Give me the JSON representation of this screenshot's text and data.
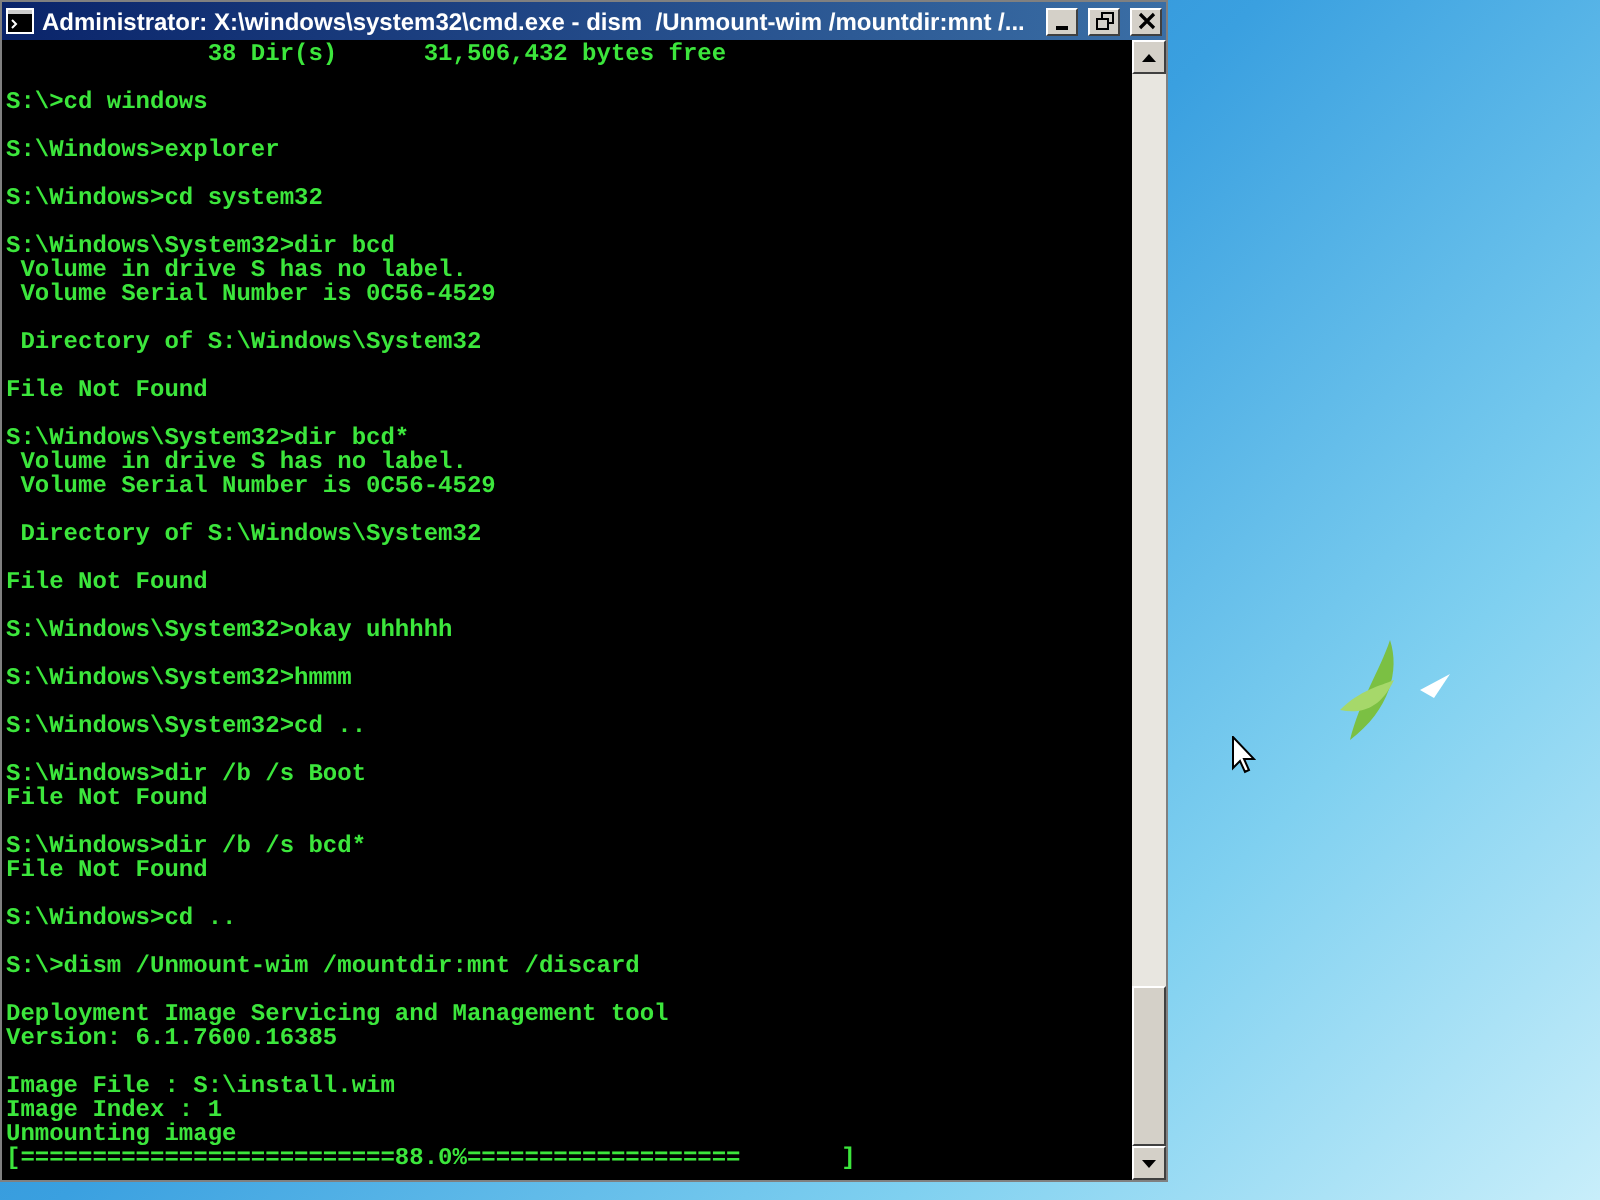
{
  "window": {
    "title": "Administrator: X:\\windows\\system32\\cmd.exe - dism  /Unmount-wim /mountdir:mnt /..."
  },
  "console": {
    "blocks": [
      [
        "              38 Dir(s)      31,506,432 bytes free"
      ],
      [
        "S:\\>cd windows"
      ],
      [
        "S:\\Windows>explorer"
      ],
      [
        "S:\\Windows>cd system32"
      ],
      [
        "S:\\Windows\\System32>dir bcd",
        " Volume in drive S has no label.",
        " Volume Serial Number is 0C56-4529"
      ],
      [
        " Directory of S:\\Windows\\System32"
      ],
      [
        "File Not Found"
      ],
      [
        "S:\\Windows\\System32>dir bcd*",
        " Volume in drive S has no label.",
        " Volume Serial Number is 0C56-4529"
      ],
      [
        " Directory of S:\\Windows\\System32"
      ],
      [
        "File Not Found"
      ],
      [
        "S:\\Windows\\System32>okay uhhhhh"
      ],
      [
        "S:\\Windows\\System32>hmmm"
      ],
      [
        "S:\\Windows\\System32>cd .."
      ],
      [
        "S:\\Windows>dir /b /s Boot",
        "File Not Found"
      ],
      [
        "S:\\Windows>dir /b /s bcd*",
        "File Not Found"
      ],
      [
        "S:\\Windows>cd .."
      ],
      [
        "S:\\>dism /Unmount-wim /mountdir:mnt /discard"
      ],
      [
        "Deployment Image Servicing and Management tool",
        "Version: 6.1.7600.16385"
      ],
      [
        "Image File : S:\\install.wim",
        "Image Index : 1",
        "Unmounting image",
        "[==========================88.0%===================       ]"
      ]
    ]
  }
}
